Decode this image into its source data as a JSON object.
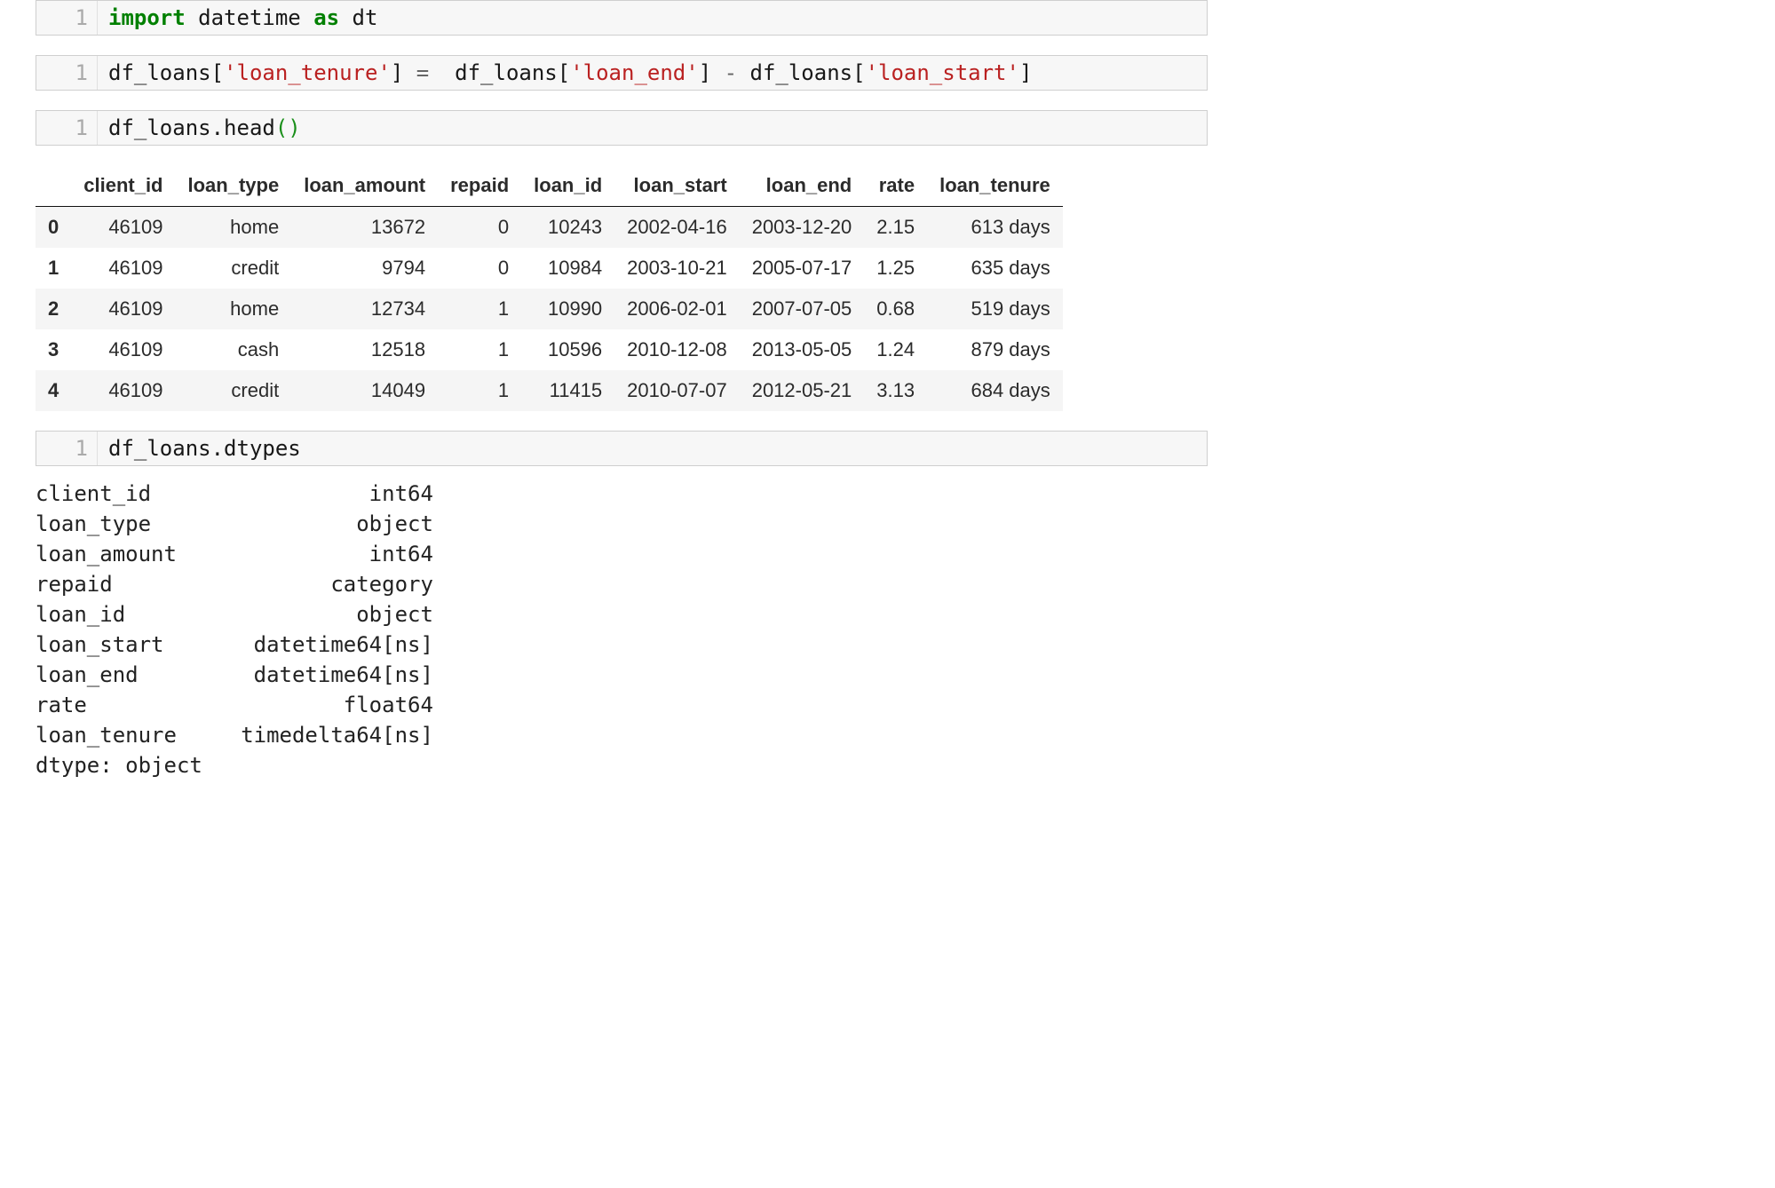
{
  "cells": [
    {
      "ln": "1",
      "tokens": [
        {
          "cls": "kw-import",
          "t": "import"
        },
        {
          "cls": "ident",
          "t": " datetime "
        },
        {
          "cls": "kw-as",
          "t": "as"
        },
        {
          "cls": "ident",
          "t": " dt"
        }
      ]
    },
    {
      "ln": "1",
      "tokens": [
        {
          "cls": "ident",
          "t": "df_loans["
        },
        {
          "cls": "str",
          "t": "'loan_tenure'"
        },
        {
          "cls": "ident",
          "t": "] "
        },
        {
          "cls": "op",
          "t": "="
        },
        {
          "cls": "ident",
          "t": "  df_loans["
        },
        {
          "cls": "str",
          "t": "'loan_end'"
        },
        {
          "cls": "ident",
          "t": "] "
        },
        {
          "cls": "op",
          "t": "-"
        },
        {
          "cls": "ident",
          "t": " df_loans["
        },
        {
          "cls": "str",
          "t": "'loan_start'"
        },
        {
          "cls": "ident",
          "t": "]"
        }
      ]
    },
    {
      "ln": "1",
      "tokens": [
        {
          "cls": "ident",
          "t": "df_loans.head"
        },
        {
          "cls": "paren",
          "t": "()"
        }
      ],
      "output_table": {
        "columns": [
          "client_id",
          "loan_type",
          "loan_amount",
          "repaid",
          "loan_id",
          "loan_start",
          "loan_end",
          "rate",
          "loan_tenure"
        ],
        "index": [
          "0",
          "1",
          "2",
          "3",
          "4"
        ],
        "rows": [
          [
            "46109",
            "home",
            "13672",
            "0",
            "10243",
            "2002-04-16",
            "2003-12-20",
            "2.15",
            "613 days"
          ],
          [
            "46109",
            "credit",
            "9794",
            "0",
            "10984",
            "2003-10-21",
            "2005-07-17",
            "1.25",
            "635 days"
          ],
          [
            "46109",
            "home",
            "12734",
            "1",
            "10990",
            "2006-02-01",
            "2007-07-05",
            "0.68",
            "519 days"
          ],
          [
            "46109",
            "cash",
            "12518",
            "1",
            "10596",
            "2010-12-08",
            "2013-05-05",
            "1.24",
            "879 days"
          ],
          [
            "46109",
            "credit",
            "14049",
            "1",
            "11415",
            "2010-07-07",
            "2012-05-21",
            "3.13",
            "684 days"
          ]
        ]
      }
    },
    {
      "ln": "1",
      "tokens": [
        {
          "cls": "ident",
          "t": "df_loans.dtypes"
        }
      ],
      "output_text": "client_id                 int64\nloan_type                object\nloan_amount               int64\nrepaid                 category\nloan_id                  object\nloan_start       datetime64[ns]\nloan_end         datetime64[ns]\nrate                    float64\nloan_tenure     timedelta64[ns]\ndtype: object"
    }
  ]
}
